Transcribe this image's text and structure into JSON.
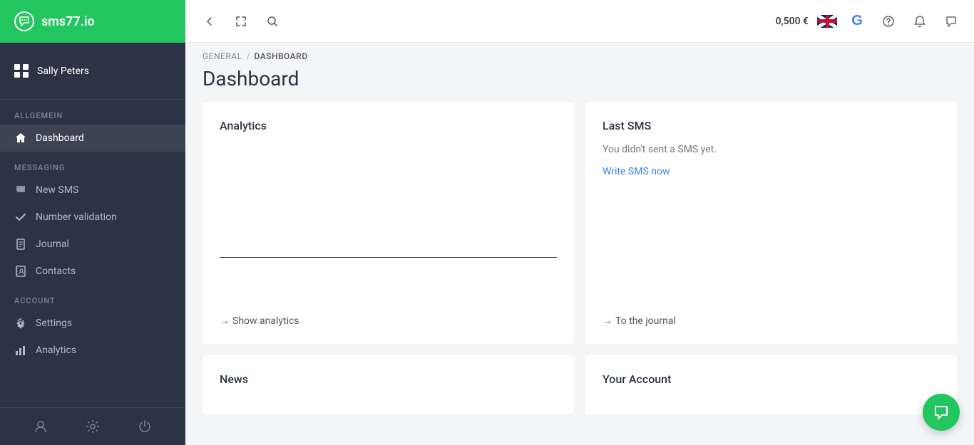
{
  "app": {
    "title": "sms77.io"
  },
  "topbar": {
    "balance": "0,500 €",
    "back_title": "Back",
    "fullscreen_title": "Fullscreen",
    "search_title": "Search"
  },
  "sidebar": {
    "user_name": "Sally Peters",
    "sections": [
      {
        "label": "ALLGEMEIN",
        "items": [
          {
            "id": "dashboard",
            "label": "Dashboard",
            "active": true
          }
        ]
      },
      {
        "label": "MESSAGING",
        "items": [
          {
            "id": "new-sms",
            "label": "New SMS",
            "active": false
          },
          {
            "id": "number-validation",
            "label": "Number validation",
            "active": false
          },
          {
            "id": "journal",
            "label": "Journal",
            "active": false
          },
          {
            "id": "contacts",
            "label": "Contacts",
            "active": false
          }
        ]
      },
      {
        "label": "ACCOUNT",
        "items": [
          {
            "id": "settings",
            "label": "Settings",
            "active": false
          },
          {
            "id": "analytics",
            "label": "Analytics",
            "active": false
          }
        ]
      }
    ]
  },
  "breadcrumb": {
    "parent": "GENERAL",
    "current": "DASHBOARD"
  },
  "page": {
    "title": "Dashboard"
  },
  "analytics_card": {
    "title": "Analytics",
    "show_link": "Show analytics"
  },
  "last_sms_card": {
    "title": "Last SMS",
    "no_sms_text": "You didn't sent a SMS yet.",
    "write_link": "Write SMS now",
    "journal_link": "To the journal"
  },
  "news_card": {
    "title": "News"
  },
  "account_card": {
    "title": "Your Account"
  }
}
